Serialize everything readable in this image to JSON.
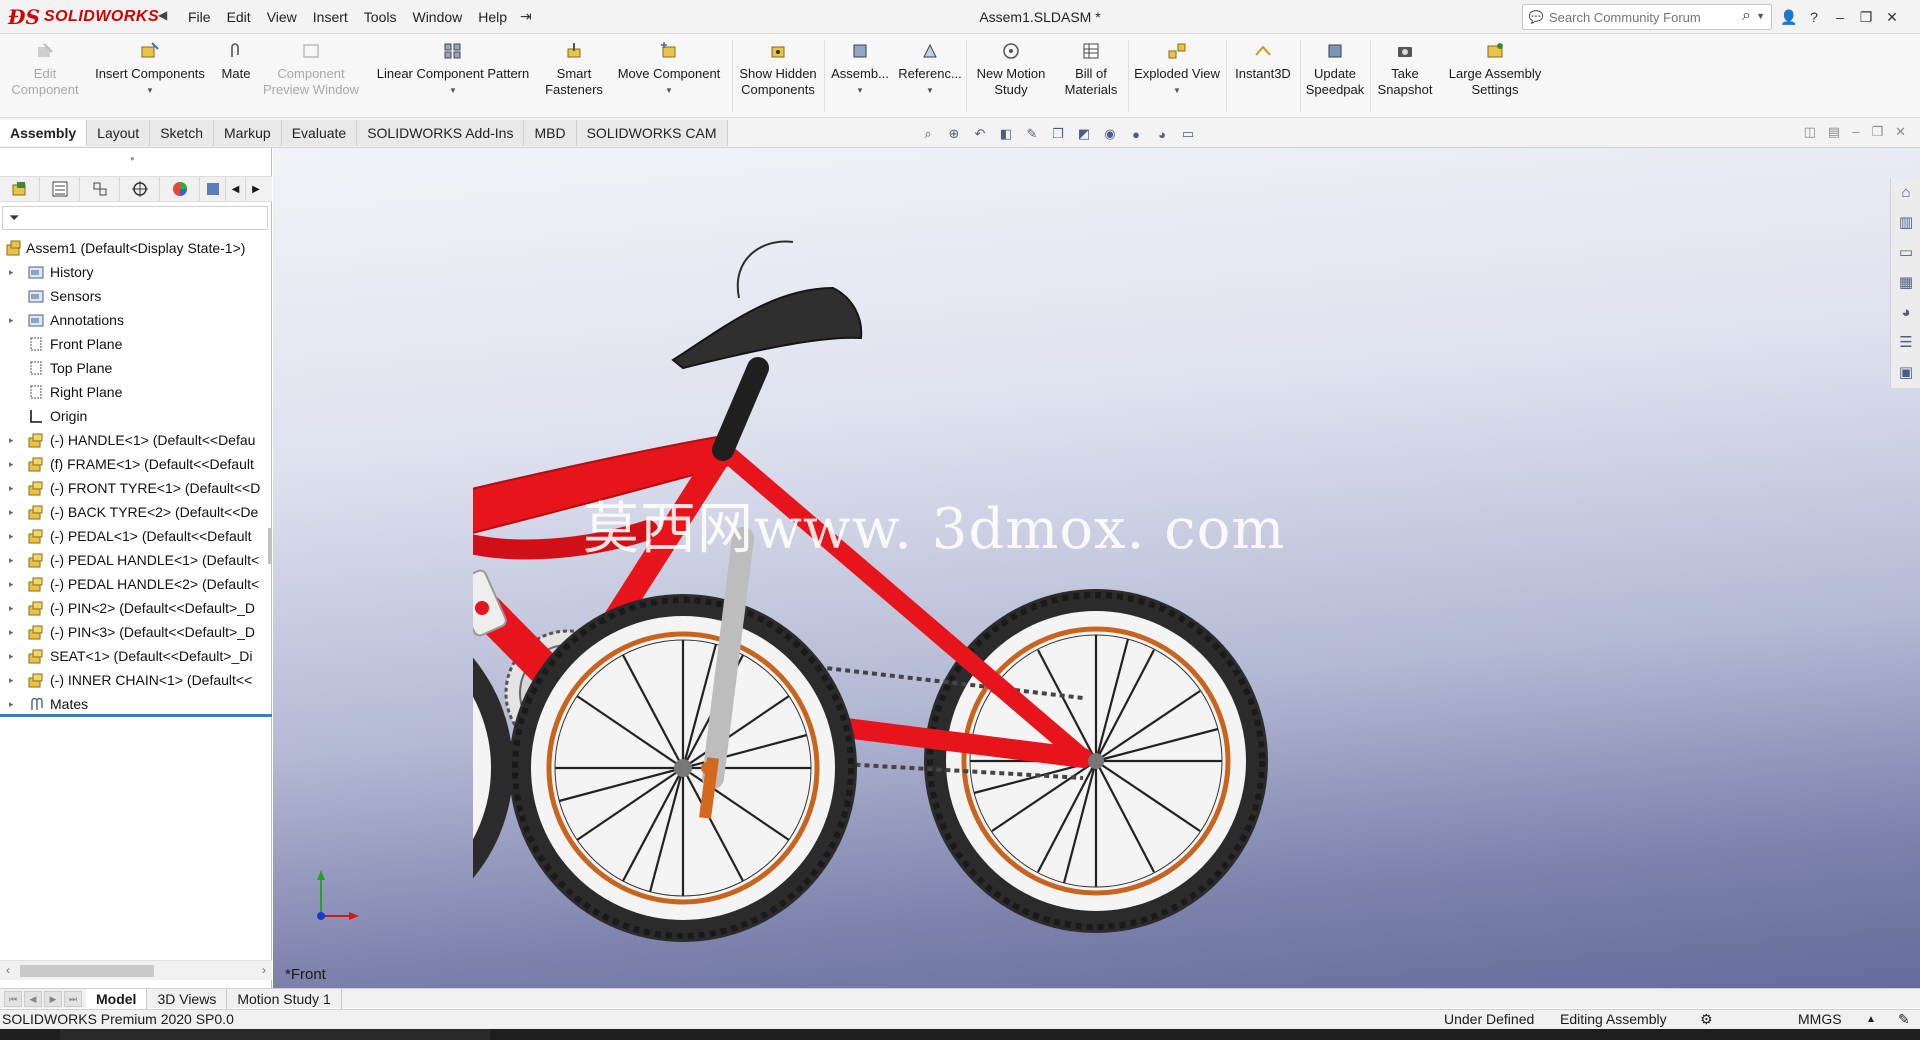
{
  "app": {
    "logo_text": "SOLIDWORKS",
    "document_title": "Assem1.SLDASM *"
  },
  "menus": [
    "File",
    "Edit",
    "View",
    "Insert",
    "Tools",
    "Window",
    "Help"
  ],
  "search": {
    "placeholder": "Search Community Forum"
  },
  "command_manager": {
    "edit_component": [
      "Edit",
      "Component"
    ],
    "insert_components": "Insert Components",
    "mate": "Mate",
    "component_preview": [
      "Component",
      "Preview Window"
    ],
    "linear_pattern": "Linear Component Pattern",
    "smart_fasteners": [
      "Smart",
      "Fasteners"
    ],
    "move_component": "Move Component",
    "show_hidden": [
      "Show Hidden",
      "Components"
    ],
    "assembly_features": "Assemb...",
    "reference_geometry": "Referenc...",
    "new_motion_study": [
      "New Motion",
      "Study"
    ],
    "bill_of_materials": [
      "Bill of",
      "Materials"
    ],
    "exploded_view": "Exploded View",
    "instant3d": "Instant3D",
    "update_speedpak": [
      "Update",
      "Speedpak"
    ],
    "take_snapshot": [
      "Take",
      "Snapshot"
    ],
    "large_assembly": [
      "Large Assembly",
      "Settings"
    ]
  },
  "tabs": [
    "Assembly",
    "Layout",
    "Sketch",
    "Markup",
    "Evaluate",
    "SOLIDWORKS Add-Ins",
    "MBD",
    "SOLIDWORKS CAM"
  ],
  "tree": {
    "root": "Assem1  (Default<Display State-1>)",
    "nodes": [
      "History",
      "Sensors",
      "Annotations",
      "Front Plane",
      "Top Plane",
      "Right Plane",
      "Origin",
      "(-) HANDLE<1> (Default<<Defau",
      "(f) FRAME<1> (Default<<Default",
      "(-) FRONT TYRE<1> (Default<<D",
      "(-) BACK TYRE<2> (Default<<De",
      "(-) PEDAL<1> (Default<<Default",
      "(-) PEDAL HANDLE<1> (Default<",
      "(-) PEDAL HANDLE<2> (Default<",
      "(-) PIN<2> (Default<<Default>_D",
      "(-) PIN<3> (Default<<Default>_D",
      "SEAT<1> (Default<<Default>_Di",
      "(-) INNER CHAIN<1> (Default<<",
      "Mates"
    ]
  },
  "viewport": {
    "watermark": "莫西网www. 3dmox. com",
    "view_name": "*Front"
  },
  "bottom_tabs": [
    "Model",
    "3D Views",
    "Motion Study 1"
  ],
  "status": {
    "product": "SOLIDWORKS Premium 2020 SP0.0",
    "definition": "Under Defined",
    "mode": "Editing Assembly",
    "units": "MMGS"
  },
  "colors": {
    "frame_red": "#e8141b",
    "tyre_black": "#2b2b2b",
    "rim_orange": "#c8641e",
    "accent_blue": "#3b7cbf"
  }
}
